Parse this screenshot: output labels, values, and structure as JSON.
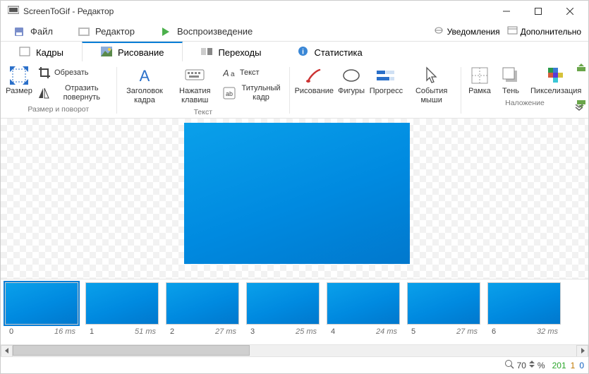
{
  "window": {
    "title": "ScreenToGif - Редактор"
  },
  "tabs_row1": {
    "file": "Файл",
    "editor": "Редактор",
    "playback": "Воспроизведение",
    "notifications": "Уведомления",
    "extra": "Дополнительно"
  },
  "tabs_row2": {
    "frames": "Кадры",
    "drawing": "Рисование",
    "transitions": "Переходы",
    "statistics": "Статистика"
  },
  "ribbon": {
    "size_rotate": {
      "size": "Размер",
      "crop": "Обрезать",
      "flip_rotate": "Отразить повернуть",
      "group": "Размер и поворот"
    },
    "text": {
      "caption": "Заголовок кадра",
      "key": "Нажатия клавиш",
      "text": "Текст",
      "title_frame": "Титульный кадр",
      "group": "Текст"
    },
    "tools": {
      "drawing": "Рисование",
      "shapes": "Фигуры",
      "progress": "Прогресс",
      "mouse_events": "События мыши"
    },
    "overlay": {
      "frame": "Рамка",
      "shadow": "Тень",
      "pixelate": "Пикселизация",
      "group": "Наложение"
    }
  },
  "thumbs": [
    {
      "index": "0",
      "ms": "16 ms"
    },
    {
      "index": "1",
      "ms": "51 ms"
    },
    {
      "index": "2",
      "ms": "27 ms"
    },
    {
      "index": "3",
      "ms": "25 ms"
    },
    {
      "index": "4",
      "ms": "24 ms"
    },
    {
      "index": "5",
      "ms": "27 ms"
    },
    {
      "index": "6",
      "ms": "32 ms"
    }
  ],
  "status": {
    "zoom": "70",
    "pct": "%",
    "total": "201",
    "selected": "1",
    "group": "0"
  }
}
